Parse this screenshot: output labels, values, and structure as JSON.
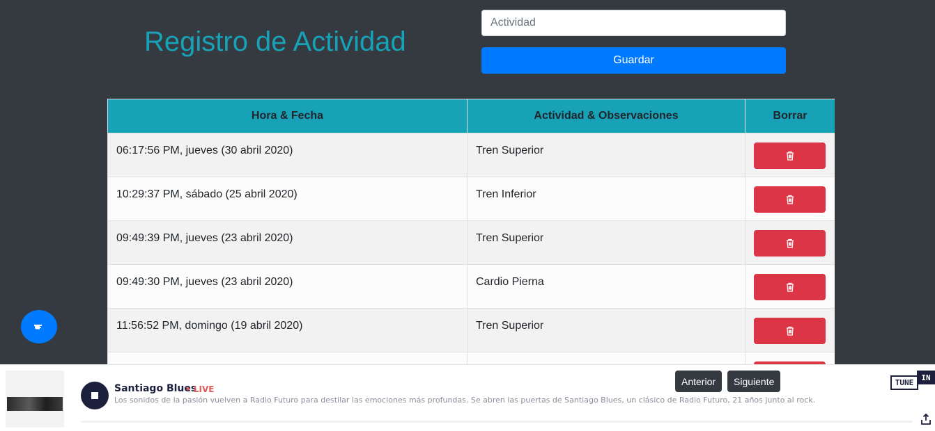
{
  "header": {
    "title": "Registro de Actividad",
    "input_placeholder": "Actividad",
    "save_label": "Guardar"
  },
  "table": {
    "columns": [
      "Hora & Fecha",
      "Actividad & Observaciones",
      "Borrar"
    ],
    "rows": [
      {
        "datetime": "06:17:56 PM, jueves (30 abril 2020)",
        "activity": "Tren Superior"
      },
      {
        "datetime": "10:29:37 PM, sábado (25 abril 2020)",
        "activity": "Tren Inferior"
      },
      {
        "datetime": "09:49:39 PM, jueves (23 abril 2020)",
        "activity": "Tren Superior"
      },
      {
        "datetime": "09:49:30 PM, jueves (23 abril 2020)",
        "activity": "Cardio Pierna"
      },
      {
        "datetime": "11:56:52 PM, domingo (19 abril 2020)",
        "activity": "Tren Superior"
      },
      {
        "datetime": "",
        "activity": ""
      }
    ],
    "delete_icon": "trash-icon"
  },
  "player": {
    "station_name": "Santiago Blues",
    "live_label": "• LIVE",
    "description": "Los sonidos de la pasión vuelven a Radio Futuro para destilar las emociones más profundas. Se abren las puertas de Santiago Blues, un clásico de Radio Futuro, 21 años junto al rock.",
    "prev_label": "Anterior",
    "next_label": "Siguiente",
    "logo_tune": "TUNE",
    "logo_in": "IN"
  },
  "colors": {
    "background": "#343a40",
    "accent": "#17a2b8",
    "primary": "#007bff",
    "danger": "#dc3545"
  }
}
